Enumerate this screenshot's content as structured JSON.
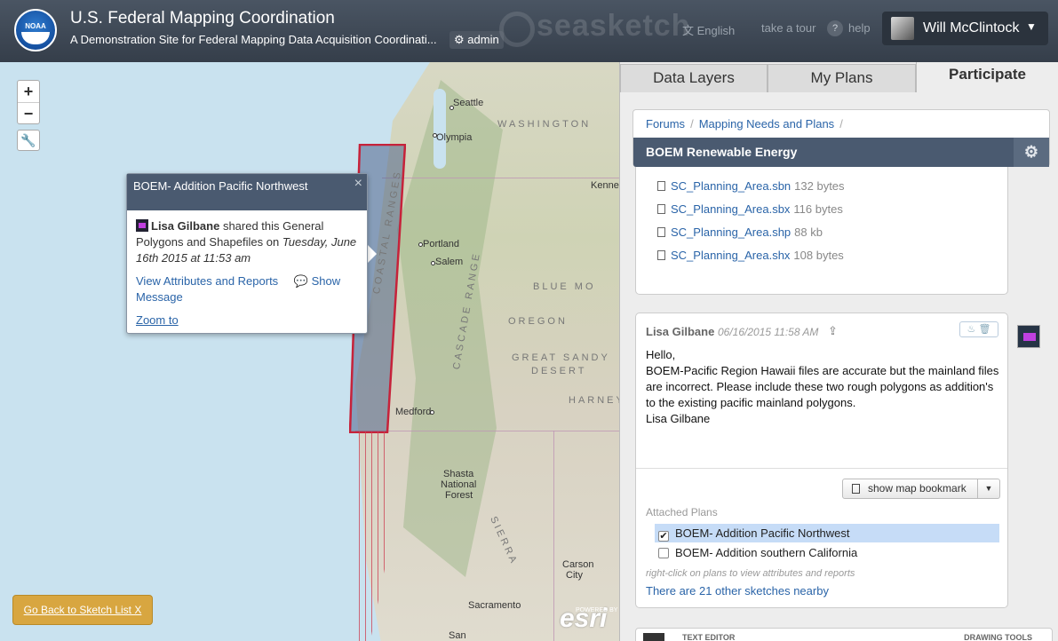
{
  "header": {
    "logo_text": "NOAA",
    "title": "U.S. Federal Mapping Coordination",
    "subtitle": "A Demonstration Site for Federal Mapping Data Acquisition Coordinati...",
    "admin_label": "admin",
    "brand": "seasketch",
    "language": "English",
    "tour": "take a tour",
    "help": "help",
    "user_name": "Will McClintock"
  },
  "map": {
    "zoom_in": "+",
    "zoom_out": "−",
    "labels": {
      "seattle": "Seattle",
      "washington": "WASHINGTON",
      "olympia": "Olympia",
      "kennewick": "Kenne",
      "portland": "Portland",
      "salem": "Salem",
      "blue_mountains": "BLUE MO",
      "oregon": "OREGON",
      "great_sandy": "GREAT SANDY",
      "desert": "DESERT",
      "harney": "HARNEY",
      "medford": "Medford",
      "shasta1": "Shasta",
      "shasta2": "National",
      "shasta3": "Forest",
      "carson1": "Carson",
      "carson2": "City",
      "sacramento": "Sacramento",
      "san": "San",
      "coastal": "COASTAL RANGES",
      "cascade": "CASCADE RANGE",
      "sierra": "SIERRA"
    },
    "powered_by": "POWERED BY",
    "esri": "esri",
    "go_back": "Go Back to Sketch List X"
  },
  "popup": {
    "title": "BOEM- Addition Pacific Northwest",
    "author": "Lisa Gilbane",
    "shared_text": "shared this General Polygons and Shapefiles on",
    "date": "Tuesday, June 16th 2015 at 11:53 am",
    "view_link": "View Attributes and Reports",
    "show_message": "Show Message",
    "zoom_to": "Zoom to"
  },
  "panel": {
    "tabs": [
      "Data Layers",
      "My Plans",
      "Participate"
    ],
    "active_tab": "Participate",
    "breadcrumbs": [
      "Forums",
      "Mapping Needs and Plans"
    ],
    "topic": "BOEM Renewable Energy",
    "files": [
      {
        "name": "SC_Planning_Area.sbn",
        "size": "132 bytes"
      },
      {
        "name": "SC_Planning_Area.sbx",
        "size": "116 bytes"
      },
      {
        "name": "SC_Planning_Area.shp",
        "size": "88 kb"
      },
      {
        "name": "SC_Planning_Area.shx",
        "size": "108 bytes"
      }
    ],
    "message": {
      "author": "Lisa Gilbane",
      "date": "06/16/2015 11:58 AM",
      "line1": "Hello,",
      "line2": "BOEM-Pacific Region Hawaii files are accurate but the mainland files are incorrect. Please include these two rough polygons as addition's to the existing pacific mainland polygons.",
      "line3": "Lisa Gilbane",
      "bookmark": "show map bookmark",
      "attached_label": "Attached Plans",
      "plans": [
        {
          "name": "BOEM- Addition Pacific Northwest",
          "checked": true
        },
        {
          "name": "BOEM- Addition southern California",
          "checked": false
        }
      ],
      "hint": "right-click on plans to view attributes and reports",
      "nearby": "There are 21 other sketches nearby"
    },
    "editor_left": "TEXT EDITOR",
    "editor_right": "DRAWING TOOLS"
  },
  "colors": {
    "header_bg": "#3f4955",
    "popup_head": "#4a5a70",
    "link": "#2a64a8",
    "polygon_outline": "#c6223a"
  }
}
